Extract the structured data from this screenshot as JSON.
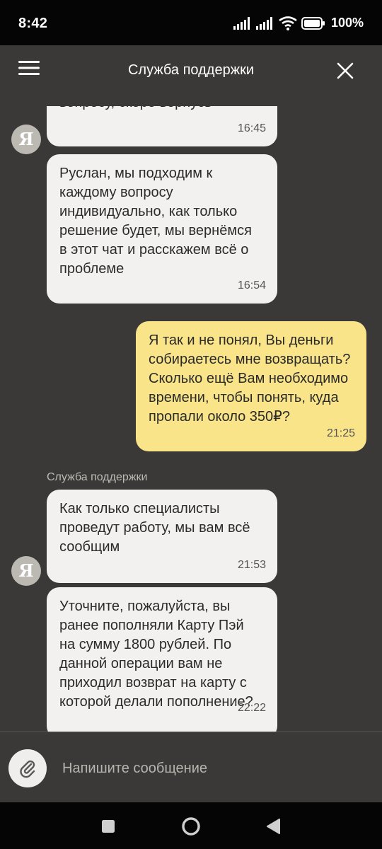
{
  "status_bar": {
    "time": "8:42",
    "battery": "100%"
  },
  "header": {
    "title": "Служба поддержки"
  },
  "messages": [
    {
      "direction": "incoming",
      "text": "вопросу, скоро вернусь",
      "time": "16:45"
    },
    {
      "direction": "incoming",
      "text": "Руслан, мы подходим к\nкаждому вопросу\nиндивидуально, как только\nрешение будет, мы вернёмся\nв этот чат и расскажем всё о\nпроблеме",
      "time": "16:54"
    },
    {
      "direction": "outgoing",
      "text": "Я так и не понял, Вы деньги\nсобираетесь мне возвращать?\nСколько ещё Вам необходимо\nвремени, чтобы понять, куда\nпропали около 350₽?",
      "time": "21:25"
    },
    {
      "direction": "incoming",
      "sender": "Служба поддержки",
      "text": "Как только специалисты\nпроведут работу, мы вам всё\nсообщим",
      "time": "21:53"
    },
    {
      "direction": "incoming",
      "text": "Уточните, пожалуйста, вы\nранее пополняли Карту Пэй\nна сумму 1800 рублей. По\nданной операции вам не\nприходил возврат на карту с\nкоторой делали пополнение?",
      "time": "22:22"
    }
  ],
  "avatar_letter": "Я",
  "composer": {
    "placeholder": "Напишите сообщение"
  },
  "colors": {
    "background": "#3b3937",
    "incoming_bubble": "#f2f1ef",
    "outgoing_bubble": "#f9e48a",
    "avatar": "#bcb9b3"
  },
  "icons": {
    "menu": "hamburger-menu-icon",
    "close": "close-icon",
    "attach": "paperclip-icon",
    "nav_recents": "square-icon",
    "nav_home": "circle-icon",
    "nav_back": "triangle-back-icon"
  }
}
